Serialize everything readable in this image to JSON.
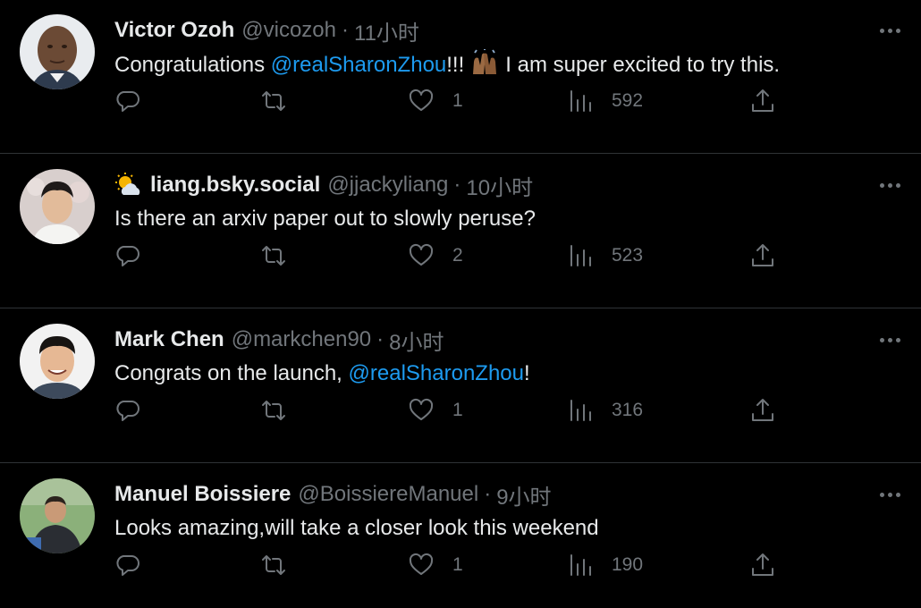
{
  "tweets": [
    {
      "name": "Victor Ozoh",
      "handle": "@vicozoh",
      "dot": "·",
      "time": "11小时",
      "text_before": "Congratulations ",
      "mention": "@realSharonZhou",
      "text_after_mention": "!!!",
      "emoji": "raising-hands-emoji",
      "text_after_emoji": "I am super excited to try this.",
      "replies": "",
      "retweets": "",
      "likes": "1",
      "views": "592"
    },
    {
      "name": "liang.bsky.social",
      "name_emoji": "sun-behind-cloud-emoji",
      "handle": "@jjackyliang",
      "dot": "·",
      "time": "10小时",
      "text": "Is there an arxiv paper out to slowly peruse?",
      "replies": "",
      "retweets": "",
      "likes": "2",
      "views": "523"
    },
    {
      "name": "Mark Chen",
      "handle": "@markchen90",
      "dot": "·",
      "time": "8小时",
      "text_before": "Congrats on the launch, ",
      "mention": "@realSharonZhou",
      "text_after_mention": "!",
      "replies": "",
      "retweets": "",
      "likes": "1",
      "views": "316"
    },
    {
      "name": "Manuel Boissiere",
      "handle": "@BoissiereManuel",
      "dot": "·",
      "time": "9小时",
      "text": "Looks amazing,will take a closer look this weekend",
      "replies": "",
      "retweets": "",
      "likes": "1",
      "views": "190"
    }
  ],
  "colors": {
    "background": "#000000",
    "text": "#e7e9ea",
    "muted": "#71767b",
    "mention": "#1d9bf0",
    "divider": "#2f3336"
  },
  "icons": [
    "reply-icon",
    "retweet-icon",
    "like-icon",
    "views-icon",
    "share-icon",
    "more-icon"
  ]
}
